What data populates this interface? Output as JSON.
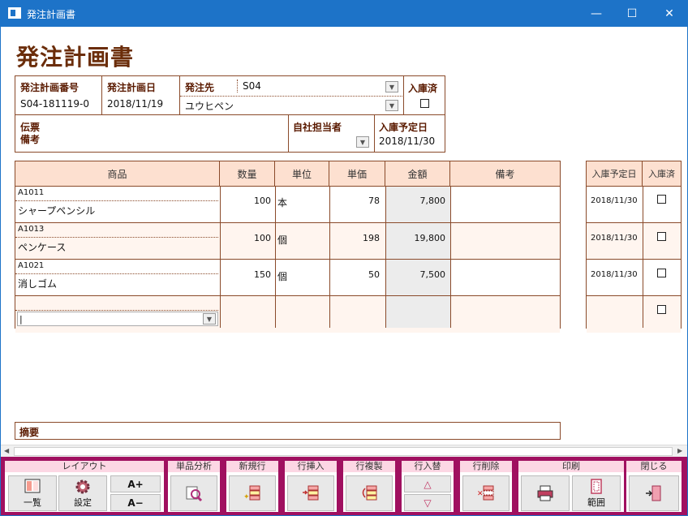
{
  "window": {
    "title": "発注計画書",
    "minimize": "—",
    "maximize": "☐",
    "close": "✕"
  },
  "doc_title": "発注計画書",
  "header": {
    "plan_no_label": "発注計画番号",
    "plan_no": "S04-181119-0",
    "plan_date_label": "発注計画日",
    "plan_date": "2018/11/19",
    "supplier_label": "発注先",
    "supplier_code": "S04",
    "supplier_name": "ユウヒペン",
    "received_label": "入庫済",
    "memo_label": "伝票\n備考",
    "staff_label": "自社担当者",
    "due_label": "入庫予定日",
    "due_date": "2018/11/30"
  },
  "table": {
    "headers": [
      "商品",
      "数量",
      "単位",
      "単価",
      "金額",
      "備考"
    ],
    "rows": [
      {
        "code": "A1011",
        "name": "シャープペンシル",
        "qty": "100",
        "unit": "本",
        "price": "78",
        "amount": "7,800",
        "due": "2018/11/30"
      },
      {
        "code": "A1013",
        "name": "ペンケース",
        "qty": "100",
        "unit": "個",
        "price": "198",
        "amount": "19,800",
        "due": "2018/11/30"
      },
      {
        "code": "A1021",
        "name": "消しゴム",
        "qty": "150",
        "unit": "個",
        "price": "50",
        "amount": "7,500",
        "due": "2018/11/30"
      }
    ],
    "new_row_input": "|"
  },
  "side_headers": {
    "due": "入庫予定日",
    "received": "入庫済"
  },
  "summary_label": "摘要",
  "toolbar": {
    "layout": {
      "title": "レイアウト",
      "list": "一覧",
      "settings": "設定",
      "font_up": "A+",
      "font_down": "A−"
    },
    "analysis": "単品分析",
    "new_row": "新規行",
    "insert_row": "行挿入",
    "copy_row": "行複製",
    "swap_row": "行入替",
    "delete_row": "行削除",
    "print": {
      "title": "印刷",
      "range": "範囲"
    },
    "close": "閉じる"
  },
  "colors": {
    "titlebar": "#1d73c8",
    "header_bg": "#fde0d0",
    "toolbar_bg": "#a01060",
    "group_header": "#fcd7e4",
    "doc_title": "#6b2d0a"
  }
}
